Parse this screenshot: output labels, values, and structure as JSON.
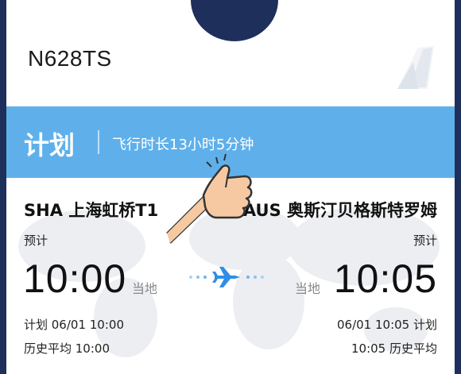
{
  "aircraft": {
    "registration": "N628TS"
  },
  "status_band": {
    "title": "计划",
    "duration": "飞行时长13小时5分钟"
  },
  "departure": {
    "code_name": "SHA 上海虹桥T1",
    "estimate_label": "预计",
    "time": "10:00",
    "local_label": "当地",
    "planned": "计划 06/01 10:00",
    "historical": "历史平均 10:00"
  },
  "arrival": {
    "code_name": "AUS 奥斯汀贝格斯特罗姆",
    "estimate_label": "预计",
    "time": "10:05",
    "local_label": "当地",
    "planned": "06/01 10:05 计划",
    "historical": "10:05 历史平均"
  },
  "colors": {
    "band": "#5fb0ea",
    "plane": "#2f8ee6",
    "background": "#1f2f5c"
  },
  "icons": [
    "airline-tail-icon",
    "airplane-icon",
    "thumbs-up-sticker"
  ]
}
